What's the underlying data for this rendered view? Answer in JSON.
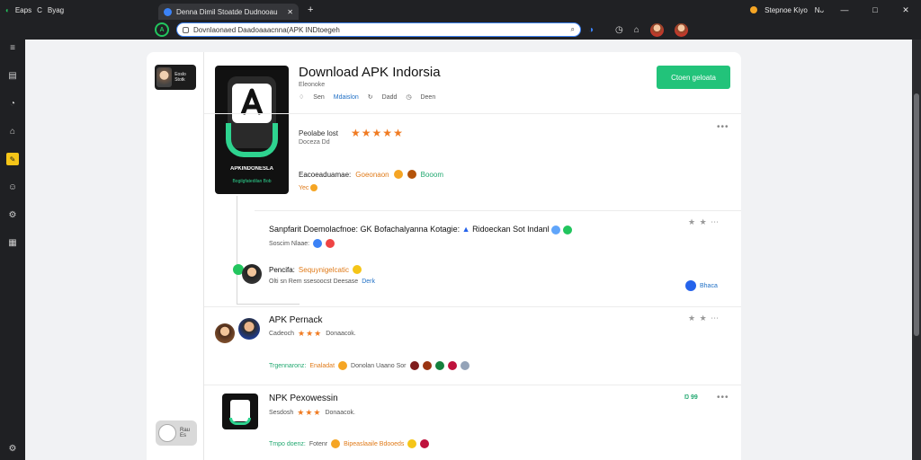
{
  "browser": {
    "left_items": [
      "Eaps",
      "C",
      "Byag"
    ],
    "tab_title": "Denna Dimil Stoatde Dudnooau",
    "new_tab": "+",
    "right_items": [
      "Stepnoe Kiyo",
      "Nᴗ"
    ],
    "window_controls": [
      "—",
      "□",
      "✕"
    ],
    "url": "Dovnlaonaed Daadoaaacnna(APK INDtoegeh"
  },
  "sidebar": {
    "thumb_text": "Eoslo Stotk",
    "toggle_label": "Rau\nEs"
  },
  "app": {
    "title": "Download APK Indorsia",
    "subtitle": "Eleonoke",
    "meta_items": [
      {
        "label": "Sen",
        "link": false
      },
      {
        "label": "Mdaislon",
        "link": true
      },
      {
        "label": "Dadd",
        "link": false
      },
      {
        "label": "Deen",
        "link": false
      }
    ],
    "install_label": "Ctoen geloata",
    "icon_caption1": "APKINDONESLA",
    "icon_caption2": "Bogilgfatedilan Bob"
  },
  "rating": {
    "label": "Peolabe lost",
    "stars": "★★★★★",
    "sub": "Doceza Dd"
  },
  "category": {
    "label": "Eacoeaduamae:",
    "orange": "Goeonaon",
    "green": "Booom",
    "line2": "Yec"
  },
  "section1": {
    "title": "Sanpfarit Doemolacfnoe: GK Bofachalyanna Kotagie:",
    "title_end": "Ridoeckan Sot Indanl",
    "line": "Soscim Nlaae:"
  },
  "section2": {
    "name": "Pencifa:",
    "name_orange": "Sequynigelcatic",
    "line": "Olti sn Rem ssesoocst Deesase",
    "line_link": "Derk",
    "blue_tag": "Bhaca"
  },
  "section3": {
    "title": "APK Pernack",
    "line_prefix": "Cadeoch",
    "stars": "★★★",
    "line_suffix": "Donaacok.",
    "tags_green": "Trgennaronz:",
    "tags_orange": "Enaladat",
    "tags_mid": "Donolan Uaano Sor"
  },
  "section4": {
    "title": "NPK Pexowessin",
    "line_prefix": "Sesdosh",
    "stars": "★★★",
    "line_suffix": "Donaacok.",
    "badge": "Ŋ 99",
    "tags_green": "Tmpo doenz:",
    "tags_mid": "Fotenr",
    "tags_orange": "Bipeaslaaile Bdooeds"
  },
  "colors": {
    "accent_green": "#22c37a",
    "star_orange": "#f07b22",
    "link_blue": "#1f6fc5",
    "chrome_dark": "#202124"
  }
}
